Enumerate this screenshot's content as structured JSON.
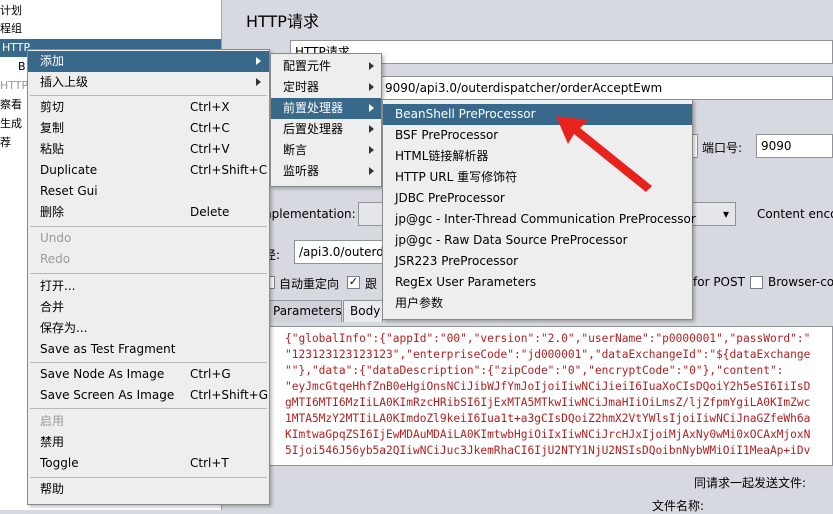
{
  "tree": {
    "items": [
      "计划",
      "程组",
      "HTTP",
      "B",
      "HTTP",
      "察看",
      "生成",
      "荐"
    ]
  },
  "panel": {
    "title": "HTTP请求",
    "name_value": "HTTP请求",
    "path_value": "9090/api3.0/outerdispatcher/orderAcceptEwm",
    "port_label": "端口号:",
    "port_value": "9090",
    "impl_label": "nplementation:",
    "content_encoding_label": "Content enco",
    "path_label": "径:",
    "path2_value": "/api3.0/outerdis",
    "follow_redirect": "自动重定向",
    "follow_label": "跟",
    "for_post": "for POST",
    "browser_compat": "Browser-co",
    "tab_params": "Parameters",
    "tab_body": "Body",
    "send_files_label": "同请求一起发送文件:",
    "file_name_label": "文件名称:",
    "code_lines": [
      "{\"globalInfo\":{\"appId\":\"00\",\"version\":\"2.0\",\"userName\":\"p0000001\",\"passWord\":\"",
      "\"123123123123123\",\"enterpriseCode\":\"jd000001\",\"dataExchangeId\":\"${dataExchange",
      "\"\"},\"data\":{\"dataDescription\":{\"zipCode\":\"0\",\"encryptCode\":\"0\"},\"content\":",
      "\"eyJmcGtqeHhfZnB0eHgiOnsNCiJibWJfYmJoIjoiIiwNCiJieiI6IuaXoCIsDQoiY2h5eSI6IiIsD",
      "gMTI6MTI6MzIiLA0KImRzcHRibSI6IjExMTA5MTkwIiwNCiJmaHIiOiLmsZ/ljZfpmYgiLA0KImZwc",
      "1MTA5MzY2MTIiLA0KImdoZl9keiI6Iua1t+a3gCIsDQoiZ2hmX2VtYWlsIjoiIiwNCiJnaGZfeWh6a",
      "KImtwaGpqZSI6IjEwMDAuMDAiLA0KImtwbHgiOiIxIiwNCiJrcHJxIjoiMjAxNy0wMi0xOCAxMjoxN",
      "5Ijoi546J56yb5a2QIiwNCiJuc3JkemRhaCI6IjU2NTY1NjU2NSIsDQoibnNybWMiOiI1MeaAp+iDv"
    ]
  },
  "context_menu": {
    "items": [
      {
        "label": "添加",
        "shortcut": "",
        "submenu": true,
        "highlighted": true,
        "disabled": false
      },
      {
        "label": "插入上级",
        "shortcut": "",
        "submenu": true,
        "highlighted": false,
        "disabled": false
      },
      {
        "label": "剪切",
        "shortcut": "Ctrl+X"
      },
      {
        "label": "复制",
        "shortcut": "Ctrl+C"
      },
      {
        "label": "粘贴",
        "shortcut": "Ctrl+V"
      },
      {
        "label": "Duplicate",
        "shortcut": "Ctrl+Shift+C"
      },
      {
        "label": "Reset Gui",
        "shortcut": ""
      },
      {
        "label": "删除",
        "shortcut": "Delete"
      },
      {
        "label": "Undo",
        "shortcut": ""
      },
      {
        "label": "Redo",
        "shortcut": ""
      },
      {
        "label": "打开...",
        "shortcut": ""
      },
      {
        "label": "合并",
        "shortcut": ""
      },
      {
        "label": "保存为...",
        "shortcut": ""
      },
      {
        "label": "Save as Test Fragment",
        "shortcut": ""
      },
      {
        "label": "Save Node As Image",
        "shortcut": "Ctrl+G"
      },
      {
        "label": "Save Screen As Image",
        "shortcut": "Ctrl+Shift+G"
      },
      {
        "label": "启用",
        "shortcut": ""
      },
      {
        "label": "禁用",
        "shortcut": ""
      },
      {
        "label": "Toggle",
        "shortcut": "Ctrl+T"
      },
      {
        "label": "帮助",
        "shortcut": ""
      }
    ]
  },
  "add_submenu": {
    "items": [
      "配置元件",
      "定时器",
      "前置处理器",
      "后置处理器",
      "断言",
      "监听器"
    ]
  },
  "preprocessor_submenu": {
    "items": [
      "BeanShell PreProcessor",
      "BSF PreProcessor",
      "HTML链接解析器",
      "HTTP URL 重写修饰符",
      "JDBC PreProcessor",
      "jp@gc - Inter-Thread Communication PreProcessor",
      "jp@gc - Raw Data Source PreProcessor",
      "JSR223 PreProcessor",
      "RegEx User Parameters",
      "用户参数"
    ]
  },
  "colors": {
    "highlight": "#39698a",
    "annotation_arrow": "#e8231e"
  }
}
